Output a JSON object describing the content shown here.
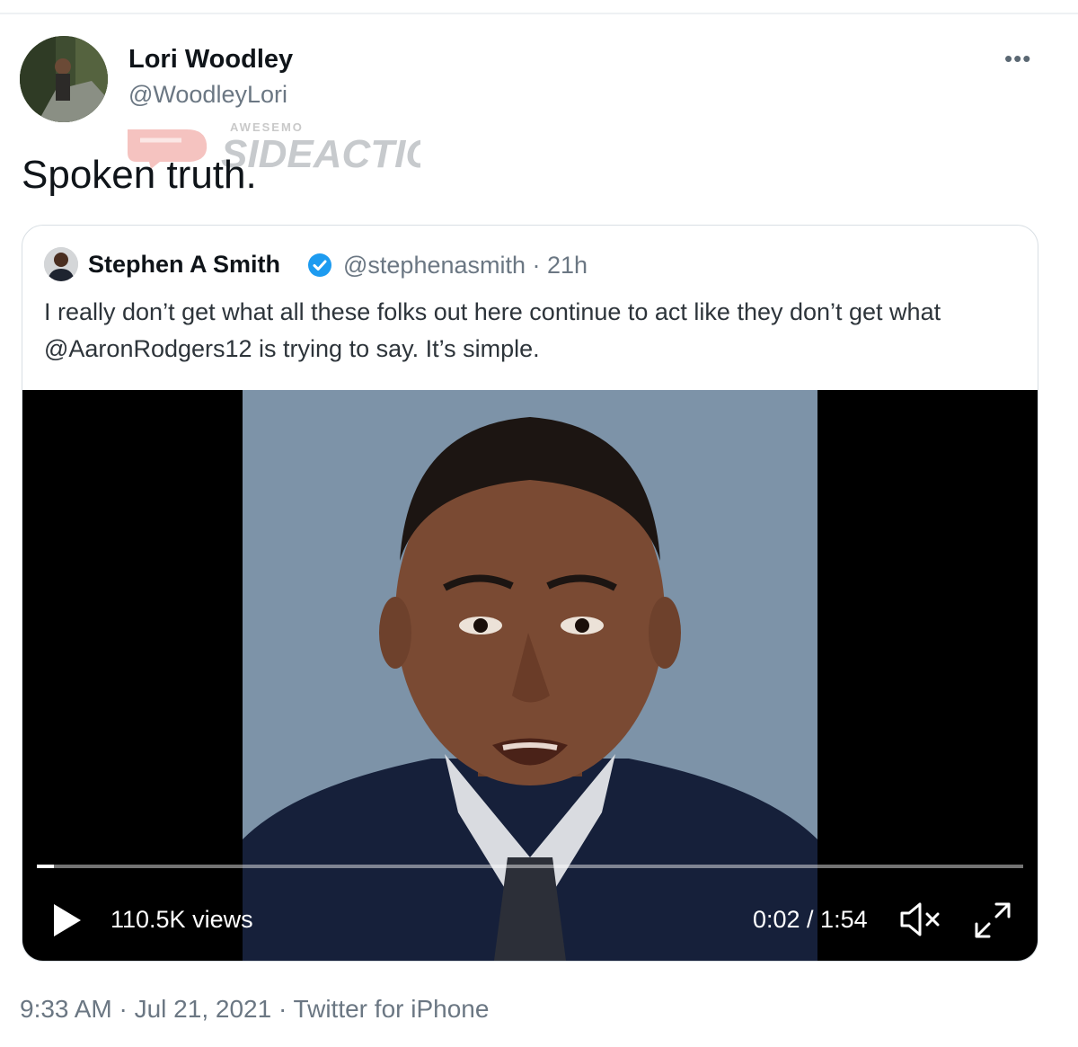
{
  "tweet": {
    "author_name": "Lori Woodley",
    "author_handle": "@WoodleyLori",
    "more_label": "•••",
    "text": "Spoken truth.",
    "footer": "9:33 AM · Jul 21, 2021 · Twitter for iPhone"
  },
  "watermark": {
    "small_text": "AWESEMO",
    "large_text": "SIDEACTION"
  },
  "quoted": {
    "author_name": "Stephen A Smith",
    "verified": true,
    "handle_time": "@stephenasmith · 21h",
    "text": "I really don’t get what all these folks out here continue to act like they don’t get what @AaronRodgers12 is trying to say. It’s simple.",
    "video": {
      "views": "110.5K views",
      "time": "0:02 / 1:54",
      "progress_fraction": 0.017,
      "icons": [
        "play-icon",
        "mute-icon",
        "fullscreen-icon"
      ]
    }
  },
  "colors": {
    "verified_blue": "#1d9bf0",
    "secondary_text": "#6b7783",
    "watermark_red": "#e2524a"
  }
}
